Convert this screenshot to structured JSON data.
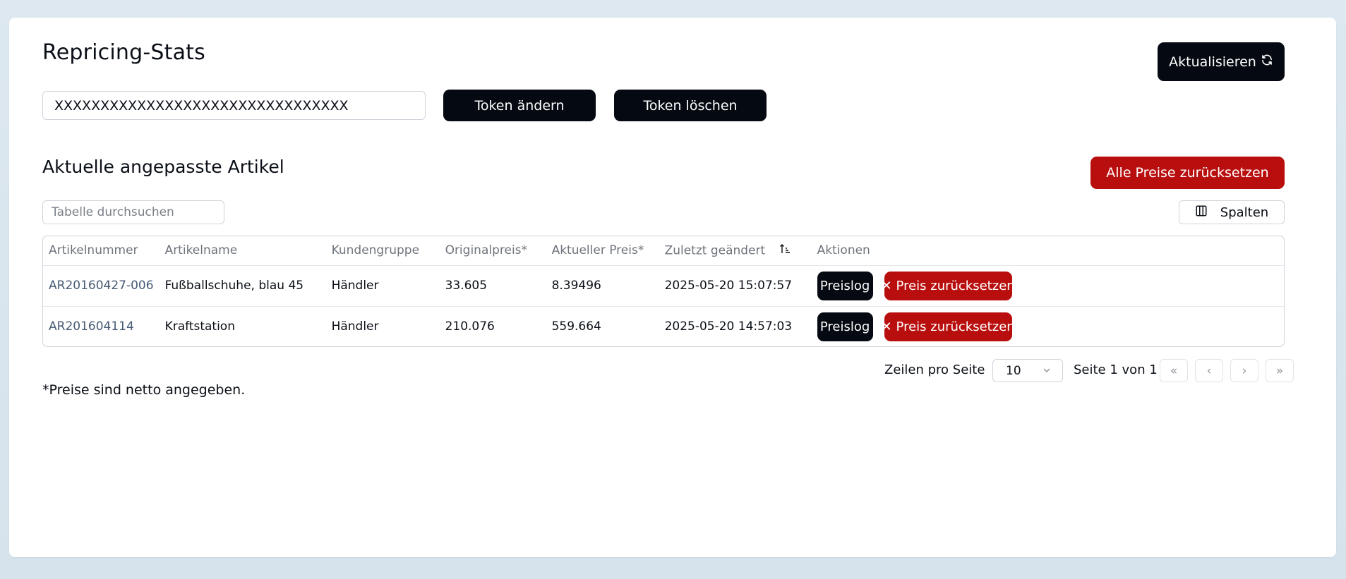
{
  "header": {
    "title": "Repricing-Stats",
    "refresh_label": "Aktualisieren"
  },
  "token": {
    "value": "XXXXXXXXXXXXXXXXXXXXXXXXXXXXXXXX",
    "change_label": "Token ändern",
    "delete_label": "Token löschen"
  },
  "section": {
    "title": "Aktuelle angepasste Artikel",
    "reset_all_label": "Alle Preise zurücksetzen",
    "search_placeholder": "Tabelle durchsuchen",
    "columns_label": "Spalten"
  },
  "table": {
    "headers": [
      "Artikelnummer",
      "Artikelname",
      "Kundengruppe",
      "Originalpreis*",
      "Aktueller Preis*",
      "Zuletzt geändert",
      "Aktionen"
    ],
    "rows": [
      {
        "article_no": "AR20160427-006",
        "name": "Fußballschuhe, blau 45",
        "group": "Händler",
        "original": "33.605",
        "current": "8.39496",
        "changed": "2025-05-20 15:07:57"
      },
      {
        "article_no": "AR201604114",
        "name": "Kraftstation",
        "group": "Händler",
        "original": "210.076",
        "current": "559.664",
        "changed": "2025-05-20 14:57:03"
      }
    ],
    "preislog_label": "Preislog",
    "reset_label": "Preis zurücksetzen"
  },
  "pagination": {
    "rows_per_page_label": "Zeilen pro Seite",
    "rows_per_page_value": "10",
    "page_info": "Seite 1 von 1"
  },
  "footnote": "*Preise sind netto angegeben.",
  "colors": {
    "dark": "#050a12",
    "danger": "#b90e0e",
    "link": "#455a73"
  }
}
